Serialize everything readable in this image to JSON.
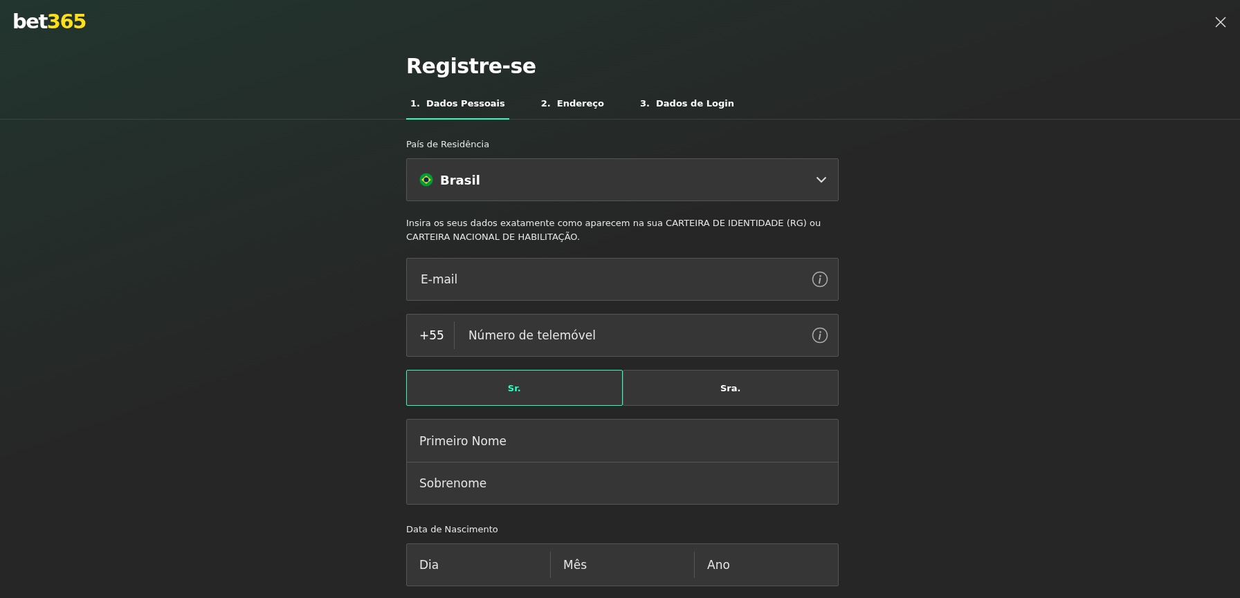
{
  "logo": {
    "part_1": "bet",
    "part_2": "365"
  },
  "title": "Registre-se",
  "tabs": [
    {
      "label": "1.  Dados Pessoais",
      "selected": true
    },
    {
      "label": "2.  Endereço",
      "selected": false
    },
    {
      "label": "3.  Dados de Login",
      "selected": false
    }
  ],
  "country": {
    "label": "País de Residência",
    "value": "Brasil"
  },
  "notice": "Insira os seus dados exatamente como aparecem na sua CARTEIRA DE IDENTIDADE (RG) ou CARTEIRA NACIONAL DE HABILITAÇÃO.",
  "email": {
    "placeholder": "E-mail"
  },
  "phone": {
    "prefix": "+55",
    "placeholder": "Número de telemóvel"
  },
  "titles": [
    {
      "label": "Sr.",
      "selected": true
    },
    {
      "label": "Sra.",
      "selected": false
    }
  ],
  "name_fields": [
    {
      "placeholder": "Primeiro Nome"
    },
    {
      "placeholder": "Sobrenome"
    }
  ],
  "birth_date": {
    "label": "Data de Nascimento",
    "fields": [
      {
        "placeholder": "Dia"
      },
      {
        "placeholder": "Mês"
      },
      {
        "placeholder": "Ano"
      }
    ]
  }
}
